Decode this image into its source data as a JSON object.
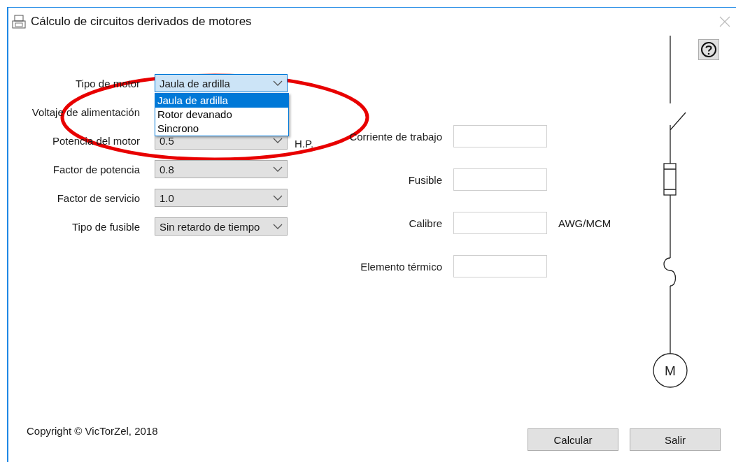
{
  "window": {
    "title": "Cálculo de circuitos derivados de motores"
  },
  "inputs": [
    {
      "label": "Tipo de motor",
      "value": "Jaula de ardilla",
      "focused": true
    },
    {
      "label": "Voltaje de alimentación"
    },
    {
      "label": "Potencia del motor",
      "value": "0.5",
      "unit": "H.P.",
      "focused": false
    },
    {
      "label": "Factor de potencia",
      "value": "0.8",
      "focused": false
    },
    {
      "label": "Factor de servicio",
      "value": "1.0",
      "focused": false
    },
    {
      "label": "Tipo de fusible",
      "value": "Sin retardo de tiempo",
      "focused": false
    }
  ],
  "dropdown": {
    "options": [
      {
        "label": "Jaula de ardilla",
        "selected": true
      },
      {
        "label": "Rotor devanado",
        "selected": false
      },
      {
        "label": "Sincrono",
        "selected": false
      }
    ]
  },
  "results": [
    {
      "label": "Corriente de trabajo"
    },
    {
      "label": "Fusible"
    },
    {
      "label": "Calibre",
      "unit": "AWG/MCM"
    },
    {
      "label": "Elemento térmico"
    }
  ],
  "diagram": {
    "motor_label": "M"
  },
  "footer": {
    "copyright": "Copyright © VicTorZel, 2018",
    "buttons": [
      "Calcular",
      "Salir"
    ]
  }
}
